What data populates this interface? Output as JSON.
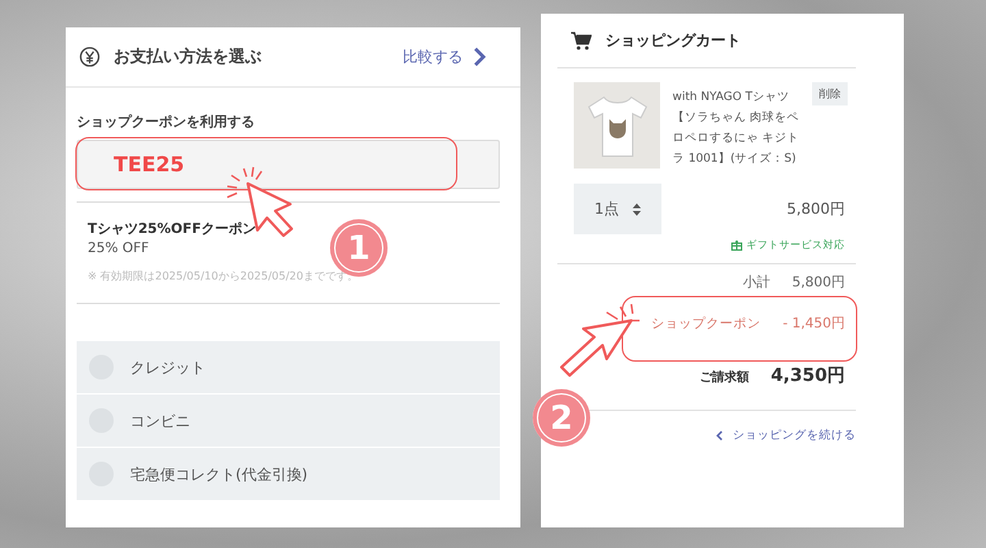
{
  "payment": {
    "title": "お支払い方法を選ぶ",
    "compare_link": "比較する",
    "coupon_label": "ショップクーポンを利用する",
    "coupon_code": "TEE25",
    "coupon": {
      "name": "Tシャツ25%OFFクーポン",
      "discount": "25% OFF",
      "note": "※ 有効期限は2025/05/10から2025/05/20までです。"
    },
    "methods": [
      {
        "label": "クレジット",
        "selected": false
      },
      {
        "label": "コンビニ",
        "selected": false
      },
      {
        "label": "宅急便コレクト(代金引換)",
        "selected": false
      }
    ]
  },
  "cart": {
    "title": "ショッピングカート",
    "item": {
      "name": "with NYAGO Tシャツ【ソラちゃん 肉球をペロペロするにゃ キジトラ 1001】(サイズ：S)",
      "delete": "削除",
      "quantity": "1点",
      "price": "5,800円",
      "gift": "ギフトサービス対応"
    },
    "subtotal_label": "小計",
    "subtotal": "5,800円",
    "coupon_label": "ショップクーポン",
    "coupon_amount": "- 1,450円",
    "total_label": "ご請求額",
    "total": "4,350円",
    "continue_link": "ショッピングを続ける"
  },
  "annotations": [
    {
      "number": "1"
    },
    {
      "number": "2"
    }
  ]
}
